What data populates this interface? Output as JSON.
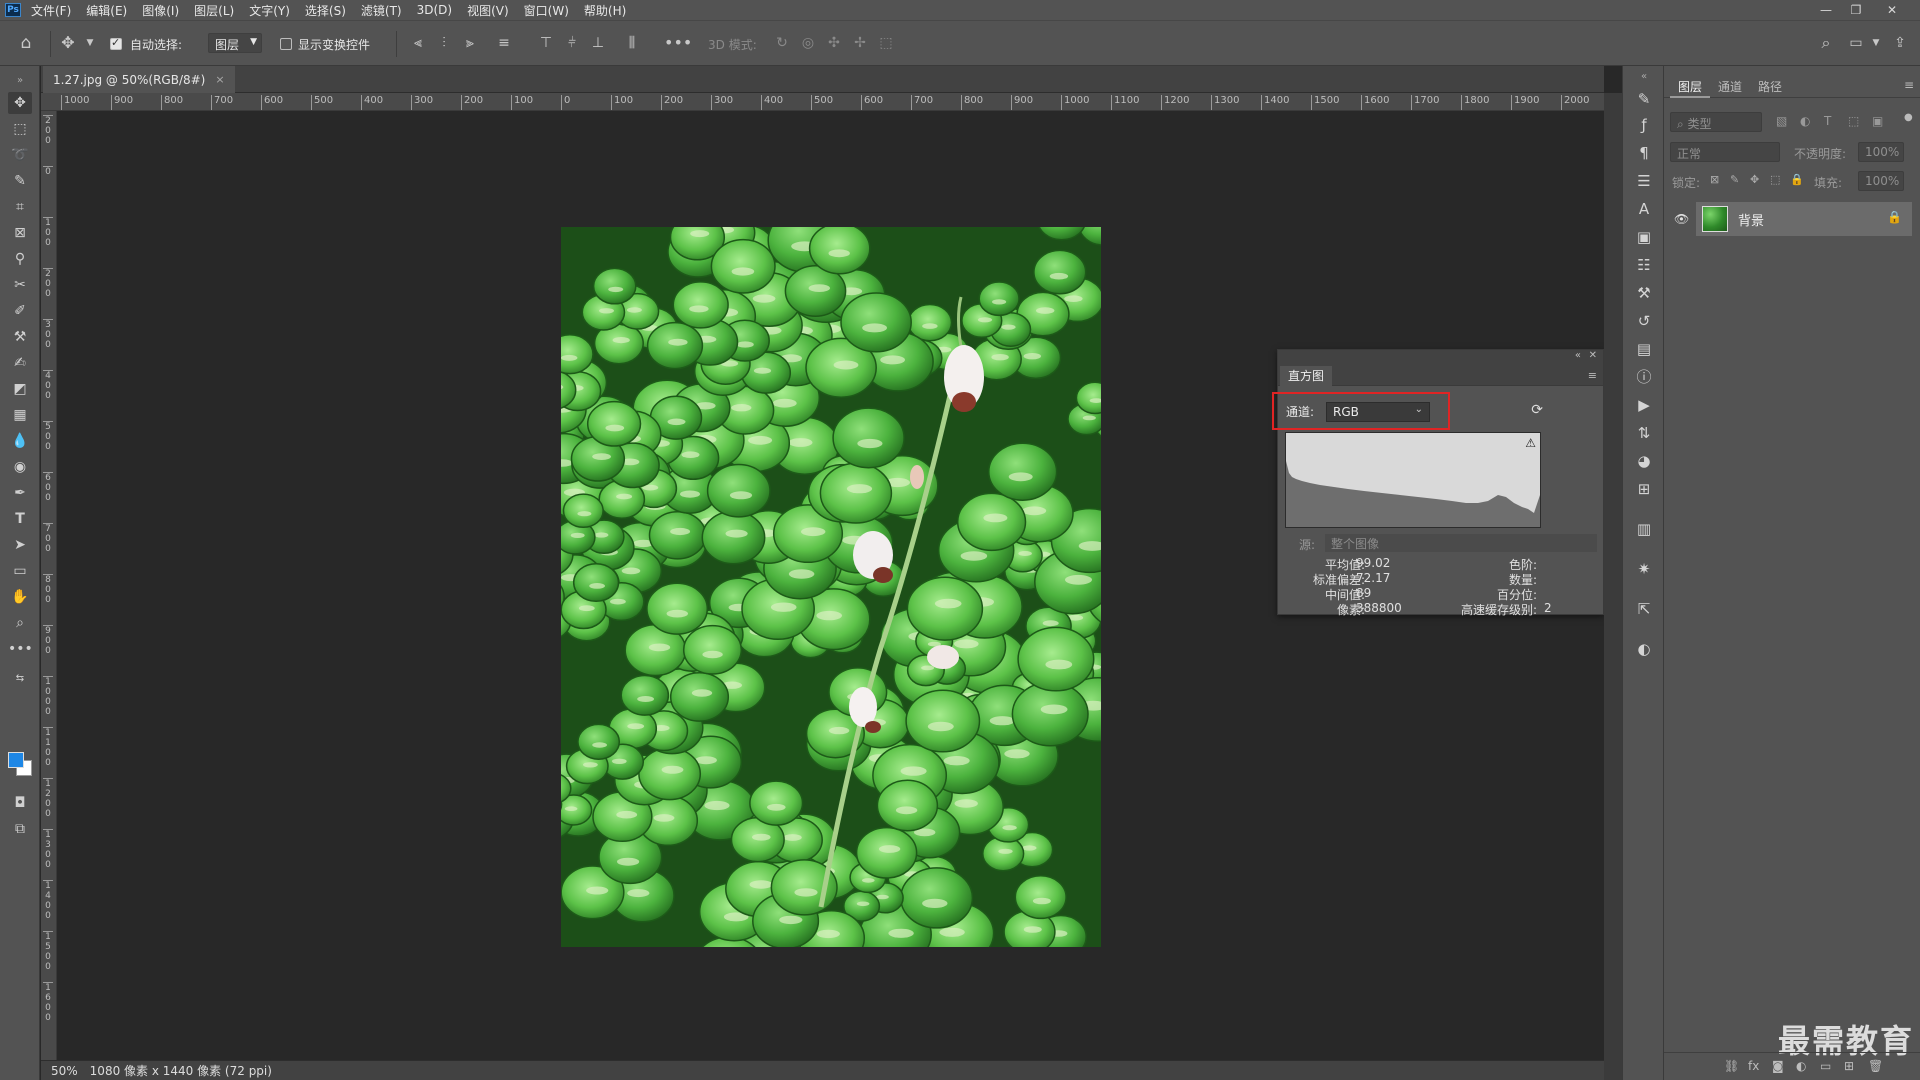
{
  "menu": {
    "logo": "Ps",
    "items": [
      "文件(F)",
      "编辑(E)",
      "图像(I)",
      "图层(L)",
      "文字(Y)",
      "选择(S)",
      "滤镜(T)",
      "3D(D)",
      "视图(V)",
      "窗口(W)",
      "帮助(H)"
    ]
  },
  "options": {
    "auto_select_label": "自动选择:",
    "auto_select_value": "图层",
    "show_transform_label": "显示变换控件",
    "mode_3d_label": "3D 模式:"
  },
  "document": {
    "tab_title": "1.27.jpg @ 50%(RGB/8#)",
    "tab_close": "×",
    "zoom": "50%",
    "status": "1080 像素 x 1440 像素 (72 ppi)"
  },
  "ruler": {
    "horizontal": [
      "1000",
      "900",
      "800",
      "700",
      "600",
      "500",
      "400",
      "300",
      "200",
      "100",
      "0",
      "100",
      "200",
      "300",
      "400",
      "500",
      "600",
      "700",
      "800",
      "900",
      "1000",
      "1100",
      "1200",
      "1300",
      "1400",
      "1500",
      "1600",
      "1700",
      "1800",
      "1900",
      "2000"
    ],
    "vertical": [
      "200",
      "0",
      "100",
      "200",
      "300",
      "400",
      "500",
      "600",
      "700",
      "800",
      "900",
      "1000",
      "1100",
      "1200",
      "1300",
      "1400",
      "1500",
      "1600"
    ]
  },
  "histogram": {
    "tab": "直方图",
    "channel_label": "通道:",
    "channel_value": "RGB",
    "source_label": "源:",
    "source_value": "整个图像",
    "stats": [
      {
        "label": "平均值:",
        "value": "99.02"
      },
      {
        "label": "标准偏差:",
        "value": "72.17"
      },
      {
        "label": "中间值:",
        "value": "89"
      },
      {
        "label": "像素:",
        "value": "388800"
      }
    ],
    "stats_right": [
      {
        "label": "色阶:",
        "value": ""
      },
      {
        "label": "数量:",
        "value": ""
      },
      {
        "label": "百分位:",
        "value": ""
      },
      {
        "label": "高速缓存级别:",
        "value": "2"
      }
    ]
  },
  "layers": {
    "tabs": [
      "图层",
      "通道",
      "路径"
    ],
    "filter_placeholder": "类型",
    "blend_mode": "正常",
    "opacity_label": "不透明度:",
    "opacity_value": "100%",
    "lock_label": "锁定:",
    "fill_label": "填充:",
    "fill_value": "100%",
    "layer_name": "背景"
  },
  "watermark": "最需教育",
  "colors": {
    "foreground": "#1e87e6",
    "background": "#ffffff",
    "highlight_box": "#e02424"
  }
}
